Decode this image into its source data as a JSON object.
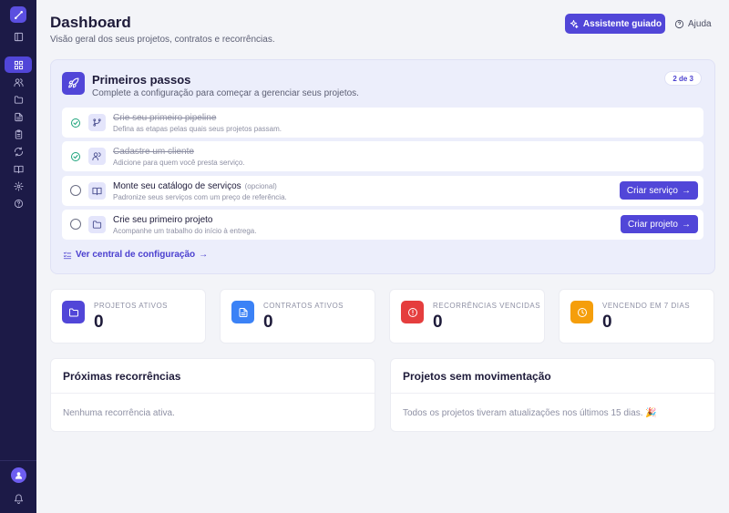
{
  "header": {
    "title": "Dashboard",
    "subtitle": "Visão geral dos seus projetos, contratos e recorrências.",
    "guided_button": "Assistente guiado",
    "help_button": "Ajuda"
  },
  "sidebar": {
    "items": [
      {
        "icon": "panel-icon"
      },
      {
        "icon": "grid-icon",
        "active": true
      },
      {
        "icon": "users-icon"
      },
      {
        "icon": "folder-icon"
      },
      {
        "icon": "document-icon"
      },
      {
        "icon": "clipboard-icon"
      },
      {
        "icon": "refresh-icon"
      },
      {
        "icon": "book-icon"
      },
      {
        "icon": "gear-icon"
      },
      {
        "icon": "help-icon"
      }
    ],
    "bottom": [
      "avatar",
      "bell-icon"
    ]
  },
  "onboarding": {
    "title": "Primeiros passos",
    "subtitle": "Complete a configuração para começar a gerenciar seus projetos.",
    "progress": "2 de 3",
    "steps": [
      {
        "title": "Crie seu primeiro pipeline",
        "desc": "Defina as etapas pelas quais seus projetos passam.",
        "done": true,
        "icon": "pipeline-icon"
      },
      {
        "title": "Cadastre um cliente",
        "desc": "Adicione para quem você presta serviço.",
        "done": true,
        "icon": "users-icon"
      },
      {
        "title": "Monte seu catálogo de serviços",
        "optional": "(opcional)",
        "desc": "Padronize seus serviços com um preço de referência.",
        "done": false,
        "icon": "book-icon",
        "action": "Criar serviço"
      },
      {
        "title": "Crie seu primeiro projeto",
        "desc": "Acompanhe um trabalho do início à entrega.",
        "done": false,
        "icon": "folder-icon",
        "action": "Criar projeto"
      }
    ],
    "link": "Ver central de configuração"
  },
  "stats": [
    {
      "label": "PROJETOS ATIVOS",
      "value": "0",
      "color": "#5146d8",
      "icon": "folder-icon"
    },
    {
      "label": "CONTRATOS ATIVOS",
      "value": "0",
      "color": "#3b82f6",
      "icon": "document-icon"
    },
    {
      "label": "RECORRÊNCIAS VENCIDAS",
      "value": "0",
      "color": "#e53e3e",
      "icon": "alert-icon"
    },
    {
      "label": "VENCENDO EM 7 DIAS",
      "value": "0",
      "color": "#f59e0b",
      "icon": "clock-icon"
    }
  ],
  "panels": {
    "recurrences": {
      "title": "Próximas recorrências",
      "empty": "Nenhuma recorrência ativa."
    },
    "stale": {
      "title": "Projetos sem movimentação",
      "empty": "Todos os projetos tiveram atualizações nos últimos 15 dias. 🎉"
    }
  }
}
